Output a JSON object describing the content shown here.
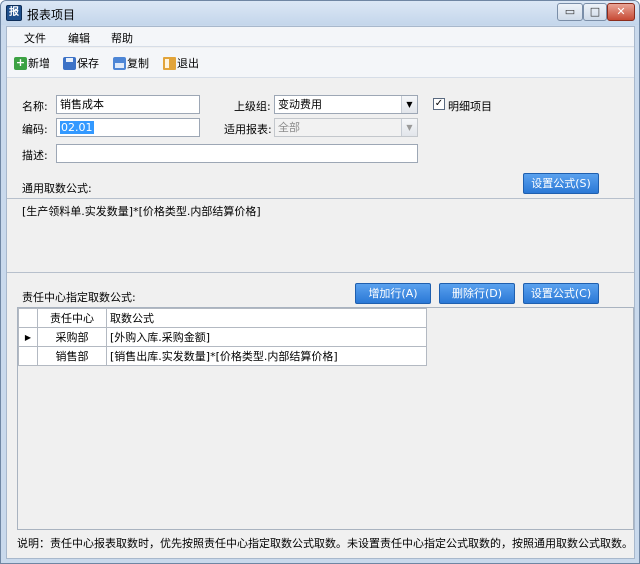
{
  "window": {
    "title": "报表项目",
    "app_icon_glyph": "报",
    "minimize_glyph": "▭",
    "maximize_glyph": "□",
    "close_glyph": "✕"
  },
  "menu": {
    "items": [
      "文件",
      "编辑",
      "帮助"
    ]
  },
  "toolbar": {
    "new_label": "新增",
    "save_label": "保存",
    "copy_label": "复制",
    "exit_label": "退出",
    "new_glyph": "+"
  },
  "form": {
    "name_label": "名称:",
    "name_value": "销售成本",
    "code_label": "编码:",
    "code_value": "02.01",
    "desc_label": "描述:",
    "desc_value": "",
    "parent_label": "上级组:",
    "parent_value": "变动费用",
    "report_label": "适用报表:",
    "report_value": "全部",
    "detail_label": "明细项目",
    "detail_checked": true,
    "check_glyph": "✓",
    "dropdown_glyph": "▼"
  },
  "general_formula": {
    "label": "通用取数公式:",
    "button": "设置公式(S)",
    "value": "[生产领料单.实发数量]*[价格类型.内部结算价格]"
  },
  "center_formula": {
    "label": "责任中心指定取数公式:",
    "add_button": "增加行(A)",
    "delete_button": "删除行(D)",
    "set_button": "设置公式(C)",
    "columns": [
      "责任中心",
      "取数公式"
    ],
    "current_row_glyph": "▶",
    "rows": [
      {
        "center": "采购部",
        "formula": "[外购入库.采购金额]",
        "current": true
      },
      {
        "center": "销售部",
        "formula": "[销售出库.实发数量]*[价格类型.内部结算价格]",
        "current": false
      }
    ]
  },
  "note": "说明：责任中心报表取数时，优先按照责任中心指定取数公式取数。未设置责任中心指定公式取数的，按照通用取数公式取数。",
  "colors": {
    "accent_button": "#2a78d6",
    "selection": "#3399ff"
  }
}
